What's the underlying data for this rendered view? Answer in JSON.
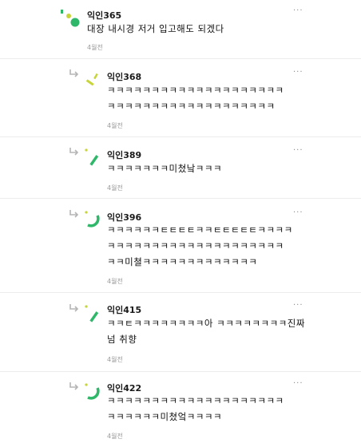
{
  "comments": [
    {
      "author": "익인365",
      "lines": [
        "대장 내시경 저거 입고해도 되겠다"
      ],
      "time": "4월전",
      "more": "···"
    },
    {
      "author": "익인368",
      "lines": [
        "ㅋㅋㅋㅋㅋㅋㅋㅋㅋㅋㅋㅋㅋㅋㅋㅋㅋㅋㅋㅋ",
        "ㅋㅋㅋㅋㅋㅋㅋㅋㅋㅋㅋㅋㅋㅋㅋㅋㅋㅋㅋ"
      ],
      "time": "4월전",
      "more": "···"
    },
    {
      "author": "익인389",
      "lines": [
        "ㅋㅋㅋㅋㅋㅋㅋ미쳤낰ㅋㅋㅋ"
      ],
      "time": "4월전",
      "more": "···"
    },
    {
      "author": "익인396",
      "lines": [
        "ㅋㅋㅋㅋㅋㅋㅌㅌㅌㅌㅋㅋㅌㅌㅌㅌㅌㅋㅋㅋㅋ",
        "ㅋㅋㅋㅋㅋㅋㅋㅋㅋㅋㅋㅋㅋㅋㅋㅋㅋㅋㅋㅋ",
        "ㅋㅋ미쳘ㅋㅋㅋㅋㅋㅋㅋㅋㅋㅋㅋㅋㅋ"
      ],
      "time": "4월전",
      "more": "···"
    },
    {
      "author": "익인415",
      "lines": [
        "ㅋㅋㅌㅋㅋㅋㅋㅋㅋㅋㅋ아 ㅋㅋㅋㅋㅋㅋㅋㅋ진짜",
        "넘 취향"
      ],
      "time": "4월전",
      "more": "···"
    },
    {
      "author": "익인422",
      "lines": [
        "ㅋㅋㅋㅋㅋㅋㅋㅋㅋㅋㅋㅋㅋㅋㅋㅋㅋㅋㅋㅋ",
        "ㅋㅋㅋㅋㅋㅋ미쳤엌ㅋㅋㅋㅋ"
      ],
      "time": "4월전",
      "more": "···"
    }
  ],
  "colors": {
    "accent_green": "#2fb86a",
    "accent_yellow": "#c7d43a",
    "arrow_gray": "#b5b5b5"
  }
}
